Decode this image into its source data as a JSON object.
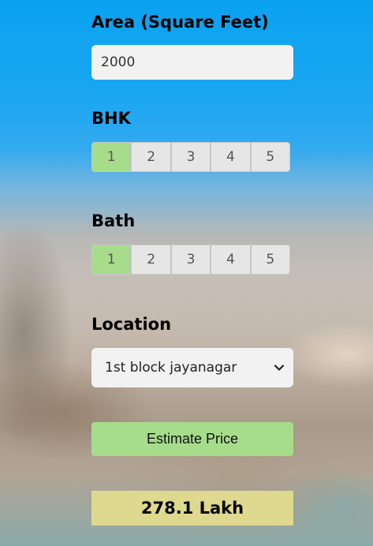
{
  "area": {
    "label": "Area (Square Feet)",
    "value": "2000"
  },
  "bhk": {
    "label": "BHK",
    "options": [
      "1",
      "2",
      "3",
      "4",
      "5"
    ],
    "selected": "1"
  },
  "bath": {
    "label": "Bath",
    "options": [
      "1",
      "2",
      "3",
      "4",
      "5"
    ],
    "selected": "1"
  },
  "location": {
    "label": "Location",
    "selected": "1st block jayanagar",
    "icon": "chevron-down-icon"
  },
  "estimate_button": {
    "label": "Estimate Price"
  },
  "result": {
    "text": "278.1 Lakh"
  },
  "colors": {
    "selected_segment": "#a7dc8a",
    "button": "#a6dd8c",
    "result_background": "#dfd98f",
    "sky": "#0aa2f0"
  }
}
